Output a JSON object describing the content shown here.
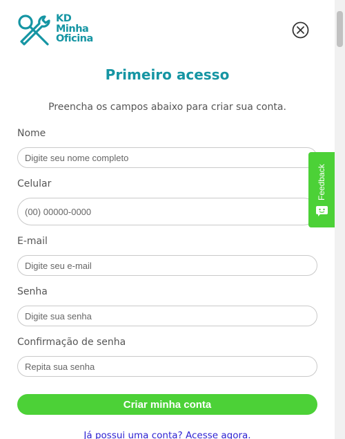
{
  "logo": {
    "line1": "KD",
    "line2": "Minha",
    "line3": "Oficina"
  },
  "title": "Primeiro acesso",
  "subtitle": "Preencha os campos abaixo para criar sua conta.",
  "fields": {
    "name": {
      "label": "Nome",
      "placeholder": "Digite seu nome completo",
      "value": ""
    },
    "phone": {
      "label": "Celular",
      "placeholder": "(00) 00000-0000",
      "value": ""
    },
    "email": {
      "label": "E-mail",
      "placeholder": "Digite seu e-mail",
      "value": ""
    },
    "password": {
      "label": "Senha",
      "placeholder": "Digite sua senha",
      "value": ""
    },
    "confirm": {
      "label": "Confirmação de senha",
      "placeholder": "Repita sua senha",
      "value": ""
    }
  },
  "submit_label": "Criar minha conta",
  "login_link": "Já possui uma conta? Acesse agora.",
  "feedback": {
    "label": "Feedback",
    "icon": "smiley-chat-icon"
  },
  "colors": {
    "brand": "#1595a3",
    "accent": "#4cd137",
    "link": "#2b1fd1"
  }
}
